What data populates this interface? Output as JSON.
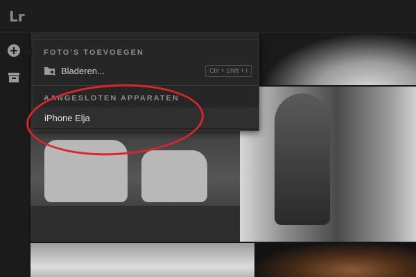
{
  "app": {
    "logo_text": "Lr"
  },
  "left_rail": {
    "items": [
      {
        "icon": "add-circle-icon"
      },
      {
        "icon": "archive-icon"
      }
    ]
  },
  "menu": {
    "add_section": {
      "header": "FOTO'S TOEVOEGEN",
      "browse_label": "Bladeren...",
      "browse_shortcut": "Ctrl + Shift + I",
      "browse_icon": "folder-search-icon"
    },
    "devices_section": {
      "header": "AANGESLOTEN APPARATEN",
      "devices": [
        "iPhone Elja"
      ]
    }
  },
  "colors": {
    "annotation": "#d9262b",
    "menu_bg": "#262626",
    "highlight_row": "#2f2f2f"
  }
}
